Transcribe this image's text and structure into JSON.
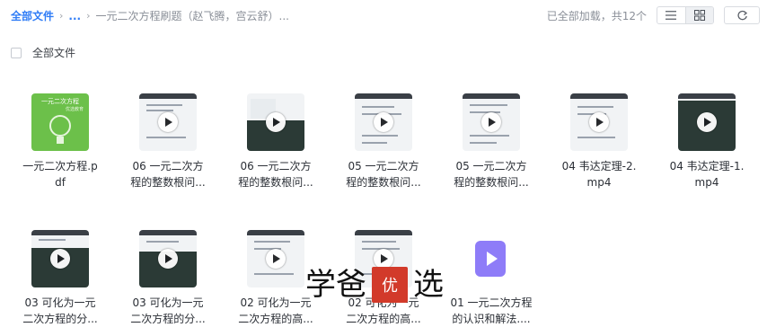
{
  "header": {
    "breadcrumb_root": "全部文件",
    "breadcrumb_ellipsis": "...",
    "breadcrumb_current": "一元二次方程刷题（赵飞腾，宫云舒）...",
    "status": "已全部加载，共12个"
  },
  "select_all_label": "全部文件",
  "files": [
    {
      "type": "pdf",
      "line1": "一元二次方程.p",
      "line2": "df",
      "cover_title": "一元二次方程",
      "cover_sub": "优选教育"
    },
    {
      "type": "video",
      "line1": "06 一元二次方",
      "line2": "程的整数根问..."
    },
    {
      "type": "video",
      "line1": "06 一元二次方",
      "line2": "程的整数根问..."
    },
    {
      "type": "video",
      "line1": "05 一元二次方",
      "line2": "程的整数根问..."
    },
    {
      "type": "video",
      "line1": "05 一元二次方",
      "line2": "程的整数根问..."
    },
    {
      "type": "video",
      "line1": "04 韦达定理-2.",
      "line2": "mp4"
    },
    {
      "type": "video",
      "line1": "04 韦达定理-1.",
      "line2": "mp4"
    },
    {
      "type": "video",
      "line1": "03 可化为一元",
      "line2": "二次方程的分..."
    },
    {
      "type": "video",
      "line1": "03 可化为一元",
      "line2": "二次方程的分..."
    },
    {
      "type": "video",
      "line1": "02 可化为一元",
      "line2": "二次方程的高..."
    },
    {
      "type": "video",
      "line1": "02 可化为一元",
      "line2": "二次方程的高..."
    },
    {
      "type": "doc",
      "line1": "01 一元二次方程",
      "line2": "的认识和解法...."
    }
  ],
  "watermark": {
    "left": "学",
    "mid": "爸",
    "seal": "优",
    "right": "选"
  },
  "colors": {
    "accent": "#2f7cf6",
    "doc_icon": "#8e7cf8",
    "pdf_cover": "#6cc04a",
    "seal": "#d23a2a"
  }
}
